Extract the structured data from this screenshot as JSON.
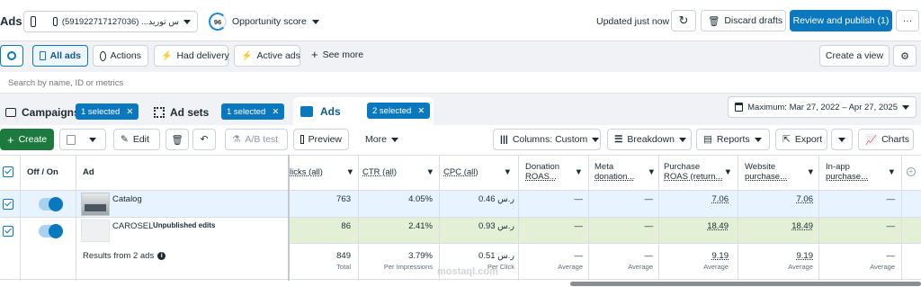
{
  "app": {
    "title": "Ads"
  },
  "account": {
    "selector": "(591922717127036) ...س تورید"
  },
  "opportunity": {
    "score": "96",
    "label": "Opportunity score"
  },
  "status": {
    "updated": "Updated just now"
  },
  "top_actions": {
    "discard": "Discard drafts",
    "review": "Review and publish (1)",
    "more": "···"
  },
  "filters": {
    "all_ads": "All ads",
    "actions": "Actions",
    "had_delivery": "Had delivery",
    "active_ads": "Active ads",
    "see_more": "See more",
    "create_view": "Create a view"
  },
  "search": {
    "placeholder": "Search by name, ID or metrics"
  },
  "tabs": [
    {
      "label": "Campaigns",
      "pill": "1 selected"
    },
    {
      "label": "Ad sets",
      "pill": "1 selected"
    },
    {
      "label": "Ads",
      "pill": "2 selected"
    }
  ],
  "date_range": "Maximum: Mar 27, 2022 – Apr 27, 2025",
  "toolbar": {
    "create": "Create",
    "edit": "Edit",
    "ab_test": "A/B test",
    "preview": "Preview",
    "more": "More",
    "columns": "Columns: Custom",
    "breakdown": "Breakdown",
    "reports": "Reports",
    "export": "Export",
    "charts": "Charts"
  },
  "table": {
    "headers": {
      "onoff": "Off / On",
      "ad": "Ad",
      "clicks": "licks (all)",
      "ctr": "CTR (all)",
      "cpc": "CPC (all)",
      "donation": [
        "Donation",
        "ROAS..."
      ],
      "meta": [
        "Meta",
        "donation..."
      ],
      "purchase": [
        "Purchase",
        "ROAS (return..."
      ],
      "website": [
        "Website",
        "purchase..."
      ],
      "inapp": [
        "In-app",
        "purchase..."
      ]
    },
    "rows": [
      {
        "name": "Catalog",
        "badge": "",
        "clicks": "763",
        "ctr": "4.05%",
        "cpc": "0.46 ر.س",
        "donation": "—",
        "meta": "—",
        "purchase": "7.06",
        "website": "7.06",
        "inapp": "—"
      },
      {
        "name": "CAROSEL",
        "badge": "Unpublished edits",
        "clicks": "86",
        "ctr": "2.41%",
        "cpc": "0.93 ر.س",
        "donation": "—",
        "meta": "—",
        "purchase": "18.49",
        "website": "18.49",
        "inapp": "—"
      }
    ],
    "totals": {
      "label": "Results from 2 ads",
      "clicks": "849",
      "clicks_sub": "Total",
      "ctr": "3.79%",
      "ctr_sub": "Per Impressions",
      "cpc": "0.51 ر.س",
      "cpc_sub": "Per Click",
      "donation": "—",
      "donation_sub": "Average",
      "meta": "—",
      "meta_sub": "Average",
      "purchase": "9.19",
      "purchase_sub": "Average",
      "website": "9.19",
      "website_sub": "Average",
      "inapp": "—",
      "inapp_sub": "Average"
    }
  },
  "watermark": "mostaql.com",
  "colors": {
    "accent": "#0a78be",
    "selected_row": "#e7f3ff",
    "highlight_row": "#e2f1d6",
    "create": "#1d7a3e"
  }
}
